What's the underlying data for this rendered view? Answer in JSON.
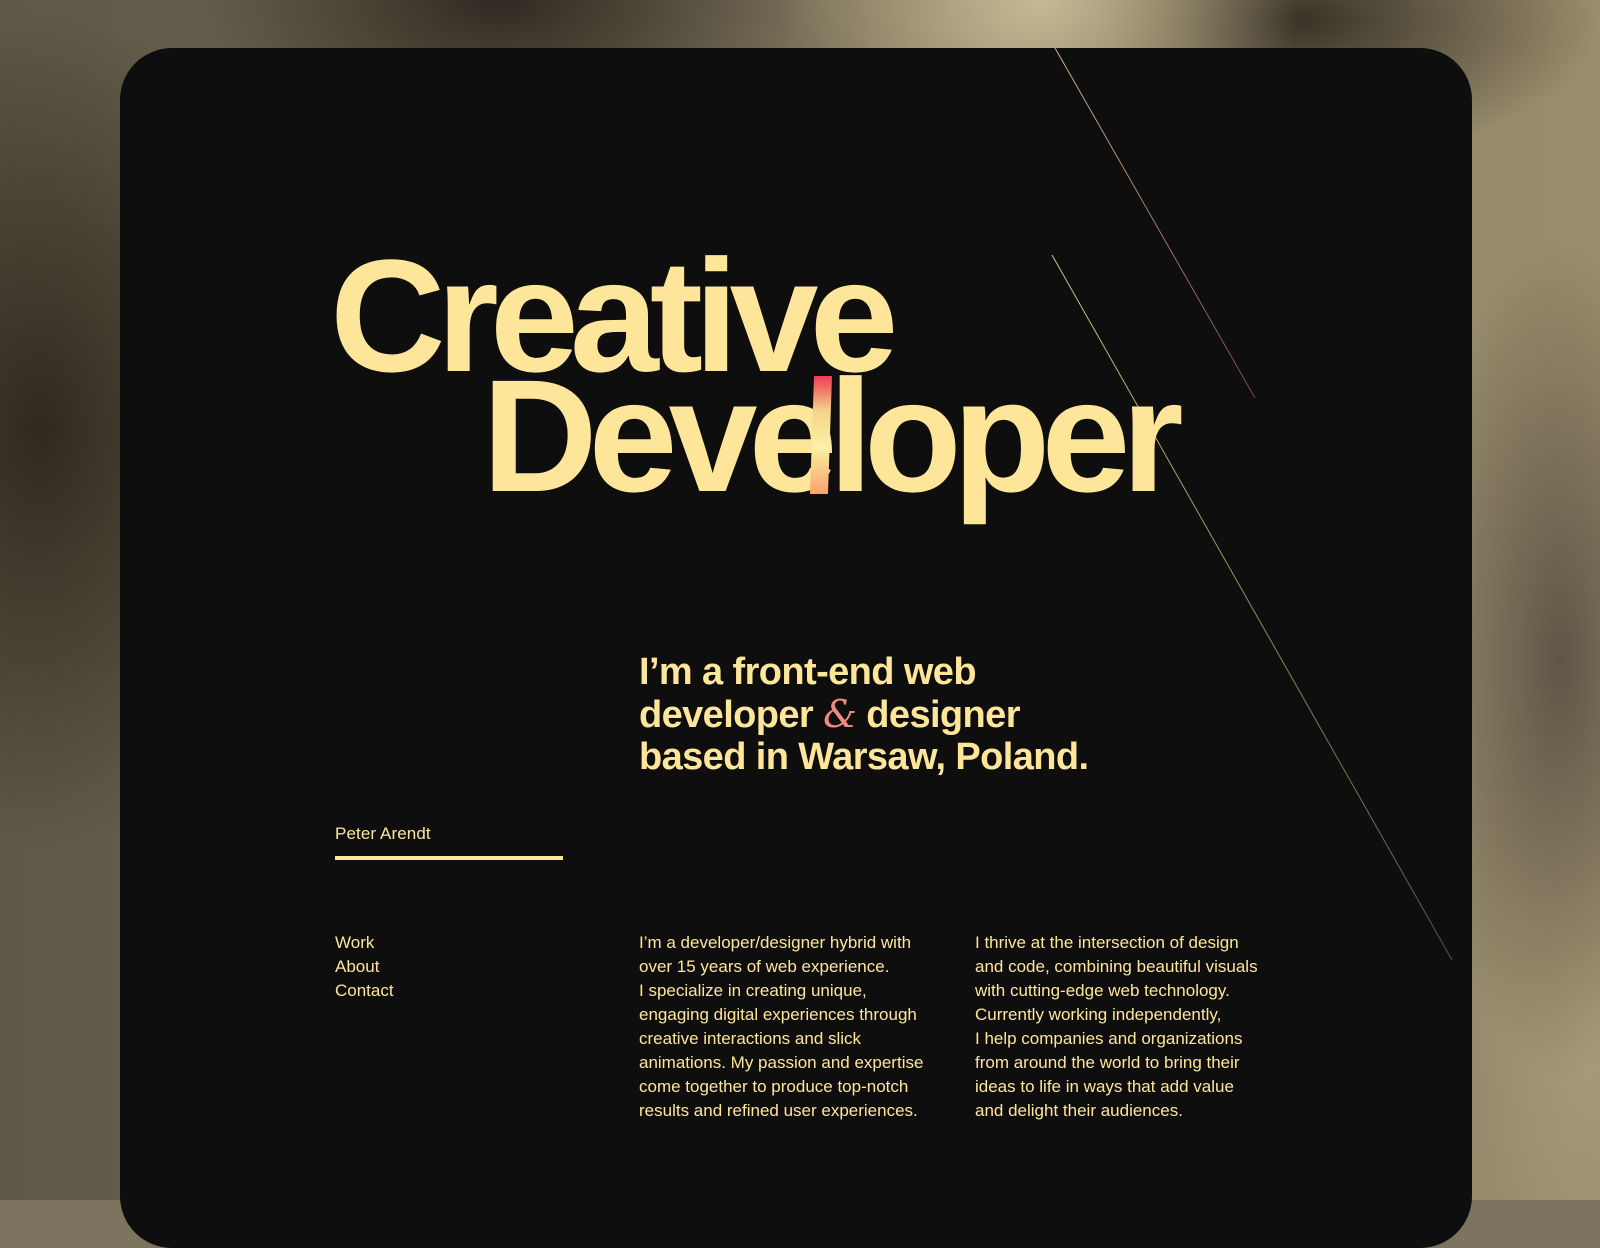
{
  "hero": {
    "line1": "Creative",
    "line2": "Developer"
  },
  "intro": {
    "line1": "I’m a front-end web",
    "line2_a": "developer",
    "ampersand": "&",
    "line2_b": "designer",
    "line3": "based in Warsaw, Poland."
  },
  "signature": {
    "name": "Peter Arendt"
  },
  "nav": {
    "items": [
      {
        "label": "Work"
      },
      {
        "label": "About"
      },
      {
        "label": "Contact"
      }
    ]
  },
  "about": {
    "column_1": [
      "I’m a developer/designer hybrid with",
      "over 15 years of web experience.",
      "I specialize in creating unique,",
      "engaging digital experiences through",
      "creative interactions and slick",
      "animations. My passion and expertise",
      "come together to produce top-notch",
      "results and refined user experiences."
    ],
    "column_2": [
      "I thrive at the intersection of design",
      "and code, combining beautiful visuals",
      "with cutting-edge web technology.",
      "Currently working independently,",
      "I help companies and organizations",
      "from around the world to bring their",
      "ideas to life in ways that add value",
      "and delight their audiences."
    ]
  },
  "colors": {
    "accent": "#fde59a",
    "background": "#0f0e0e",
    "ampersand": "#f08a7e",
    "highlight_gradient": [
      "#ef3b55",
      "#f9a26c",
      "#f9f2a4"
    ]
  }
}
